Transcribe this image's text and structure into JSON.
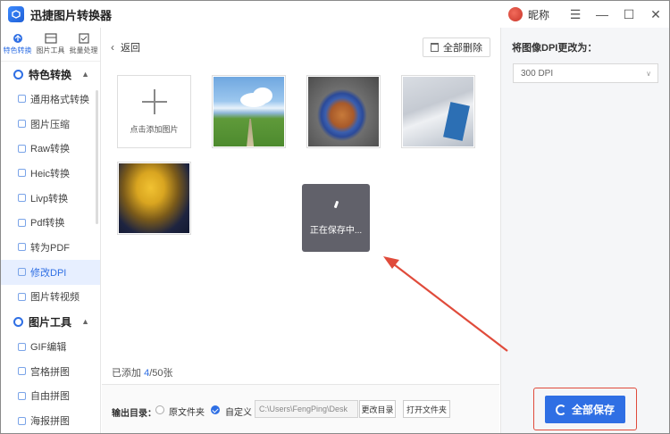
{
  "app": {
    "title": "迅捷图片转换器",
    "user_name": "昵称",
    "window_controls": [
      "menu-icon",
      "minimize-icon",
      "maximize-icon",
      "close-icon"
    ]
  },
  "topnav": [
    {
      "label": "特色转换",
      "icon": "convert-icon",
      "active": true
    },
    {
      "label": "图片工具",
      "icon": "image-tools-icon",
      "active": false
    },
    {
      "label": "批量处理",
      "icon": "batch-icon",
      "active": false
    }
  ],
  "sidebar": {
    "sections": [
      {
        "title": "特色转换",
        "items": [
          "通用格式转换",
          "图片压缩",
          "Raw转换",
          "Heic转换",
          "Livp转换",
          "Pdf转换",
          "转为PDF",
          "修改DPI",
          "图片转视频"
        ]
      },
      {
        "title": "图片工具",
        "items": [
          "GIF编辑",
          "宫格拼图",
          "自由拼图",
          "海报拼图"
        ]
      }
    ],
    "active_item": "修改DPI"
  },
  "main": {
    "back_label": "返回",
    "delete_all_label": "全部删除",
    "add_label": "点击添加图片",
    "saving_text": "正在保存中...",
    "spinner_glyph": "\\",
    "count_prefix": "已添加 ",
    "count_current": "4",
    "count_total": "/50张"
  },
  "output": {
    "label": "输出目录：",
    "option_original": "原文件夹",
    "option_custom": "自定义",
    "path_value": "C:\\Users\\FengPing\\Desk",
    "change_dir_label": "更改目录",
    "open_folder_label": "打开文件夹"
  },
  "right": {
    "dpi_title": "将图像DPI更改为：",
    "dpi_value": "300 DPI",
    "save_all_label": "全部保存"
  },
  "colors": {
    "accent": "#2f6fe4",
    "highlight": "#e04b3b",
    "overlay": "#50505a"
  }
}
